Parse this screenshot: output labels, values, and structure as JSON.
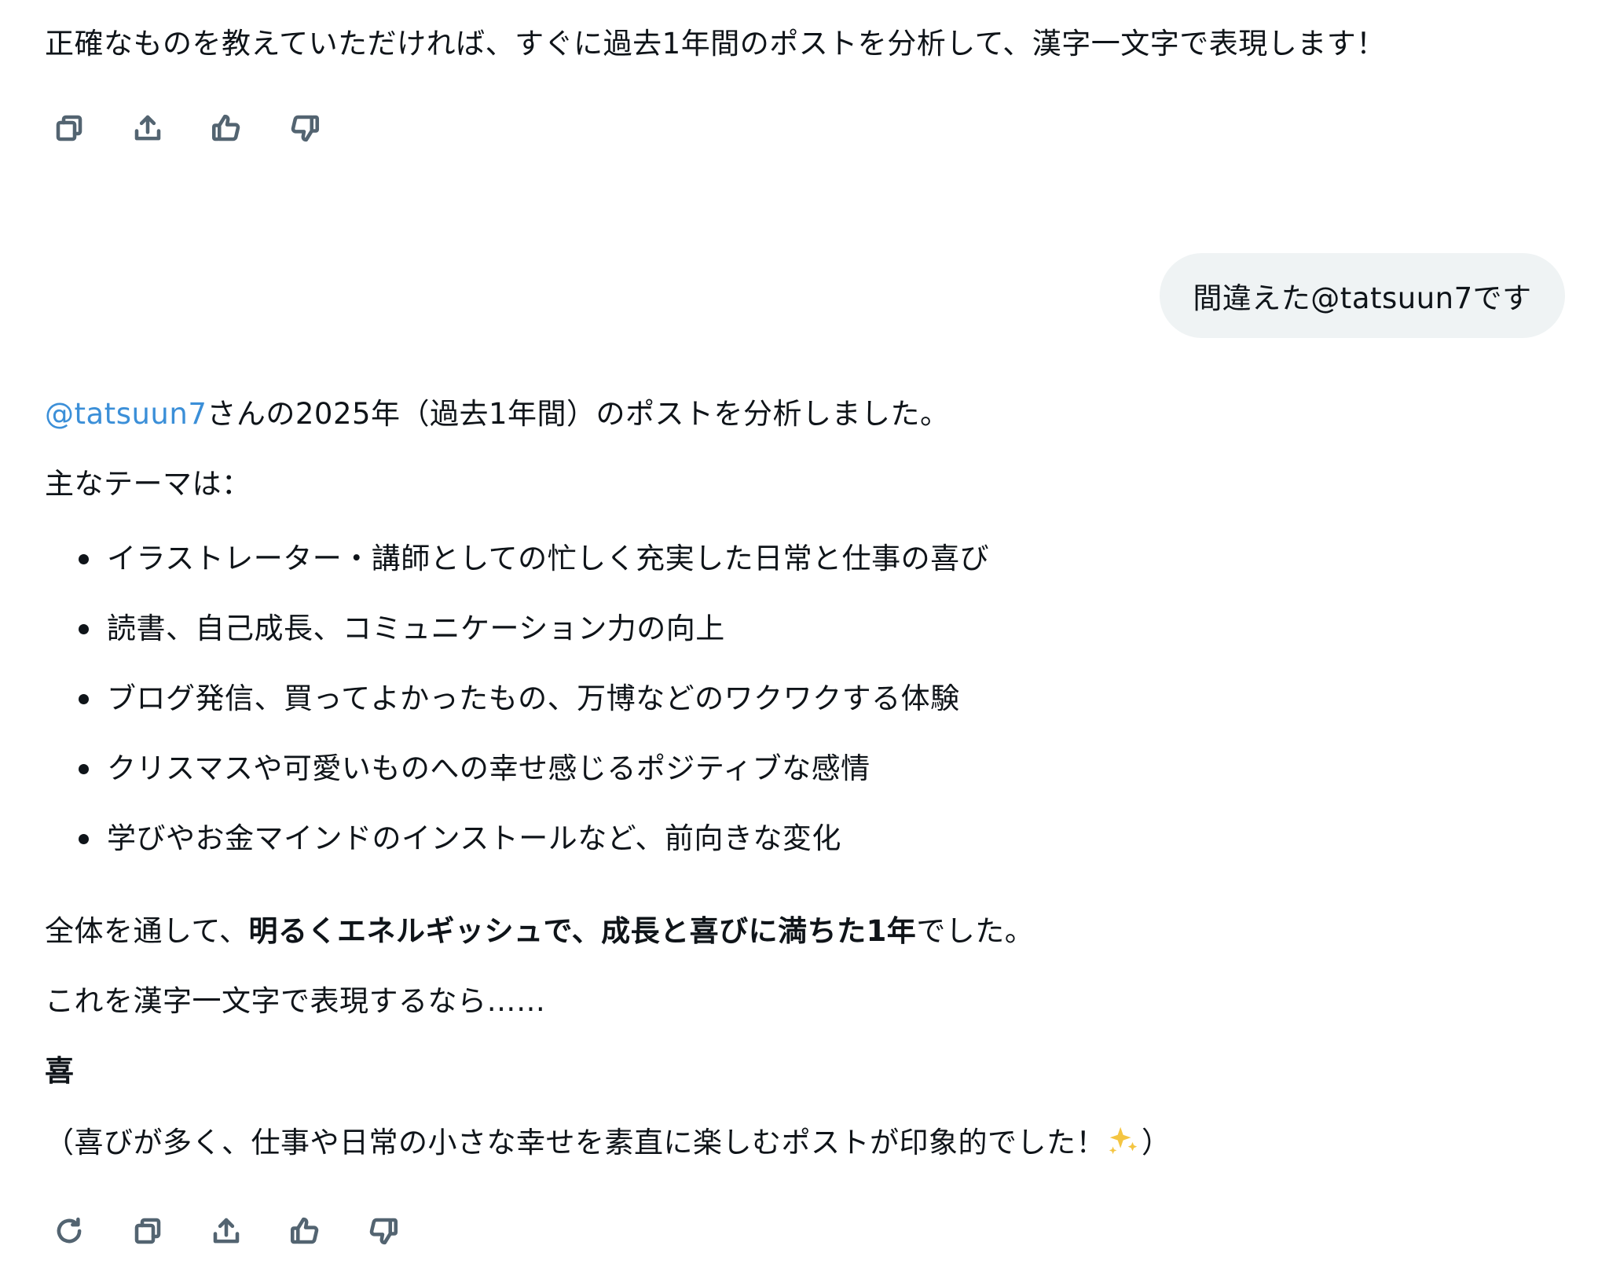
{
  "prev_message": {
    "text": "正確なものを教えていただければ、すぐに過去1年間のポストを分析して、漢字一文字で表現します！"
  },
  "prev_actions": [
    {
      "name": "copy-icon"
    },
    {
      "name": "share-icon"
    },
    {
      "name": "thumbs-up-icon"
    },
    {
      "name": "thumbs-down-icon"
    }
  ],
  "user_message": {
    "text": "間違えた@tatsuun7です"
  },
  "response": {
    "intro_mention": "@tatsuun7",
    "intro_rest": "さんの2025年（過去1年間）のポストを分析しました。",
    "themes_heading": "主なテーマは：",
    "themes": [
      "イラストレーター・講師としての忙しく充実した日常と仕事の喜び",
      "読書、自己成長、コミュニケーション力の向上",
      "ブログ発信、買ってよかったもの、万博などのワクワクする体験",
      "クリスマスや可愛いものへの幸せ感じるポジティブな感情",
      "学びやお金マインドのインストールなど、前向きな変化"
    ],
    "summary_prefix": "全体を通して、",
    "summary_bold": "明るくエネルギッシュで、成長と喜びに満ちた1年",
    "summary_suffix": "でした。",
    "kanji_lead": "これを漢字一文字で表現するなら……",
    "kanji": "喜",
    "closing_text": "（喜びが多く、仕事や日常の小さな幸せを素直に楽しむポストが印象的でした！",
    "closing_emoji_name": "sparkles-icon",
    "closing_end": "）"
  },
  "response_actions": [
    {
      "name": "regenerate-icon"
    },
    {
      "name": "copy-icon"
    },
    {
      "name": "share-icon"
    },
    {
      "name": "thumbs-up-icon"
    },
    {
      "name": "thumbs-down-icon"
    }
  ],
  "colors": {
    "text": "#0f1419",
    "mention": "#3b8fd8",
    "icon": "#536471",
    "bubble": "#eff3f4",
    "sparkle": "#f4c542"
  }
}
